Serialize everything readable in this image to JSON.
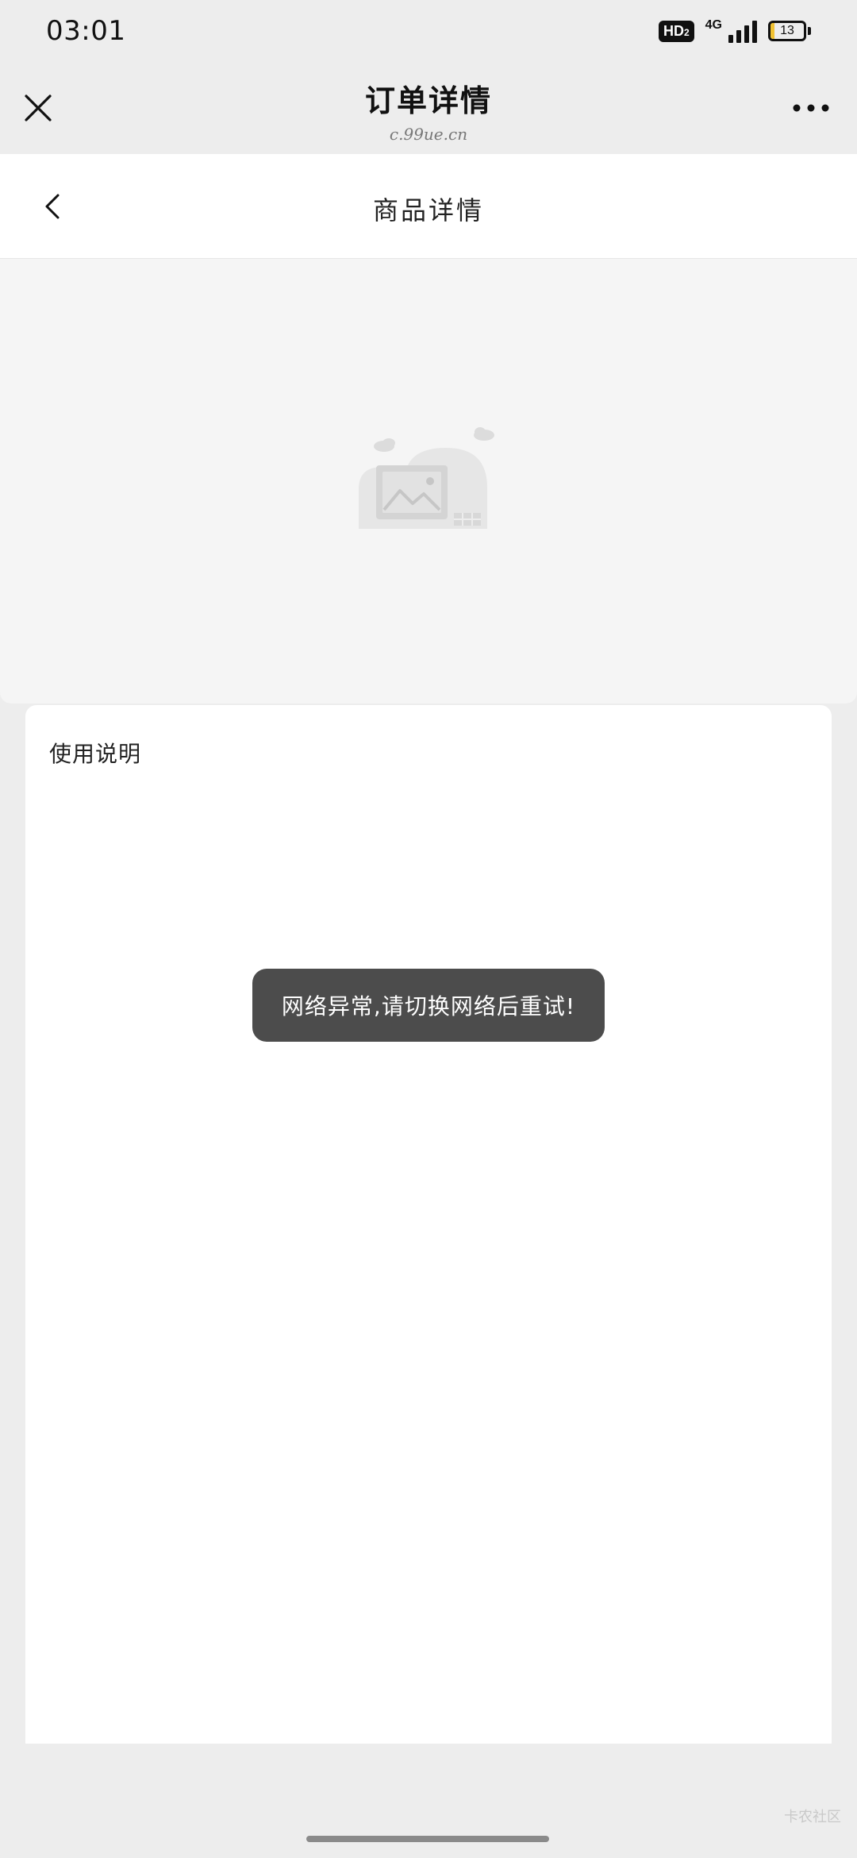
{
  "status_bar": {
    "time": "03:01",
    "hd_label": "HD",
    "hd_sub": "2",
    "network_type": "4G",
    "battery_level": "13",
    "battery_percent": 13,
    "battery_color": "#f1c232"
  },
  "top_nav": {
    "title": "订单详情",
    "subtitle": "c.99ue.cn",
    "close_icon": "close-icon",
    "more_icon": "more-horizontal-icon"
  },
  "page_header": {
    "title": "商品详情",
    "back_icon": "chevron-left-icon"
  },
  "image_placeholder": {
    "icon": "image-placeholder-icon"
  },
  "content": {
    "section_label": "使用说明"
  },
  "toast": {
    "message": "网络异常,请切换网络后重试!"
  },
  "watermark": {
    "text": "卡农社区"
  },
  "colors": {
    "page_bg": "#ededed",
    "card_bg": "#ffffff",
    "toast_bg": "#4c4c4c",
    "placeholder_bg": "#f5f5f5"
  }
}
